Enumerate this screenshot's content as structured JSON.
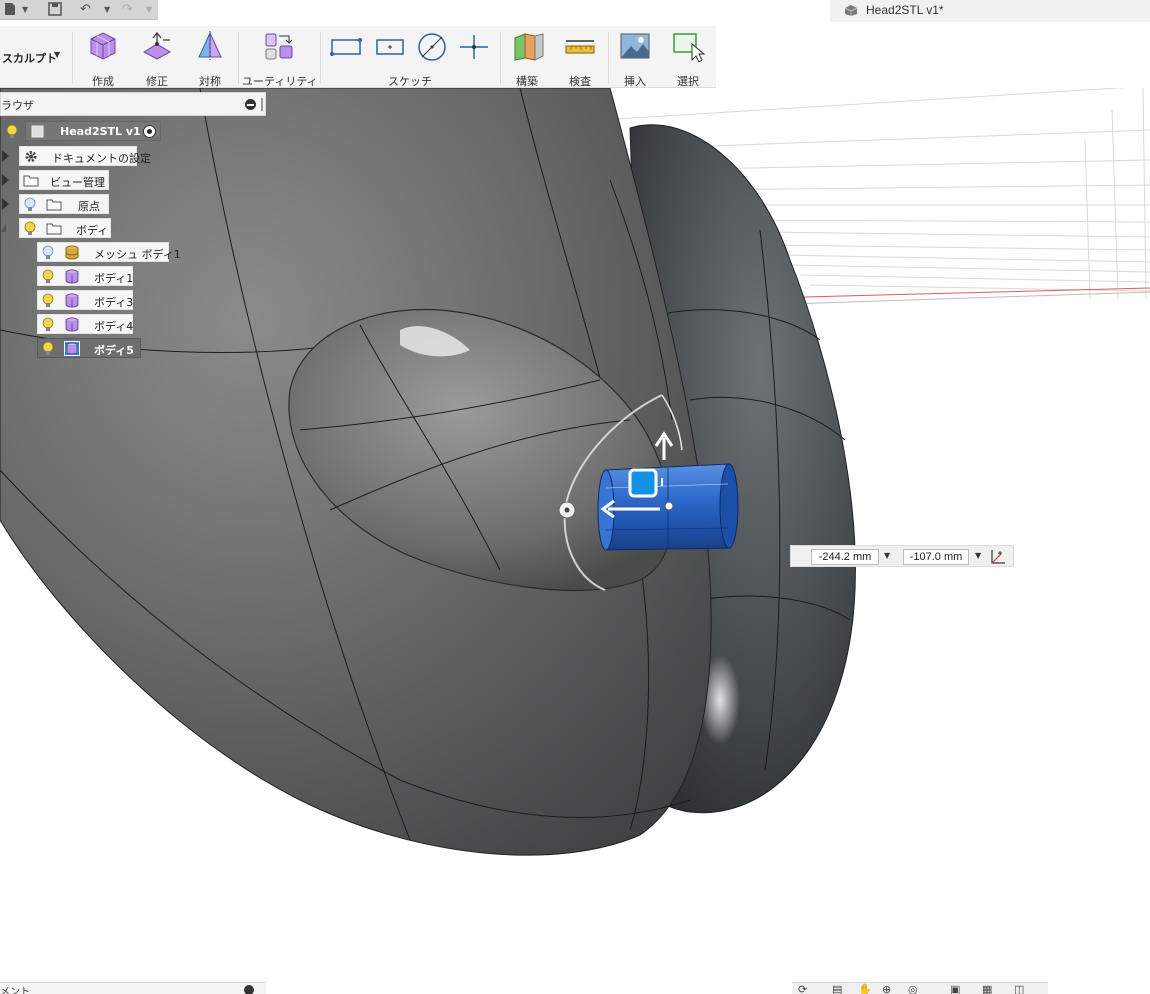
{
  "window": {
    "doc_title": "Head2STL v1*"
  },
  "toolbar": {
    "workspace": "スカルプト",
    "groups": [
      {
        "label": "作成"
      },
      {
        "label": "修正"
      },
      {
        "label": "対称"
      },
      {
        "label": "ユーティリティ"
      },
      {
        "label": "スケッチ"
      },
      {
        "label": "構築"
      },
      {
        "label": "検査"
      },
      {
        "label": "挿入"
      },
      {
        "label": "選択"
      }
    ]
  },
  "browser": {
    "title": "ラウザ",
    "nodes": [
      {
        "label": "Head2STL v1"
      },
      {
        "label": "ドキュメントの設定"
      },
      {
        "label": "ビュー管理"
      },
      {
        "label": "原点"
      },
      {
        "label": "ボディ"
      },
      {
        "label": "メッシュ ボディ1"
      },
      {
        "label": "ボディ1"
      },
      {
        "label": "ボディ3"
      },
      {
        "label": "ボディ4"
      },
      {
        "label": "ボディ5"
      }
    ]
  },
  "dimensions": {
    "x_value": "-244.2 mm",
    "y_value": "-107.0 mm"
  },
  "bottom": {
    "panel_label": "メント"
  },
  "colors": {
    "body_gray": "#5f6161",
    "selected_cylinder": "#2a66c8",
    "toolbar_bg": "#f4f4f4",
    "browser_selected": "#6e6e6e"
  }
}
